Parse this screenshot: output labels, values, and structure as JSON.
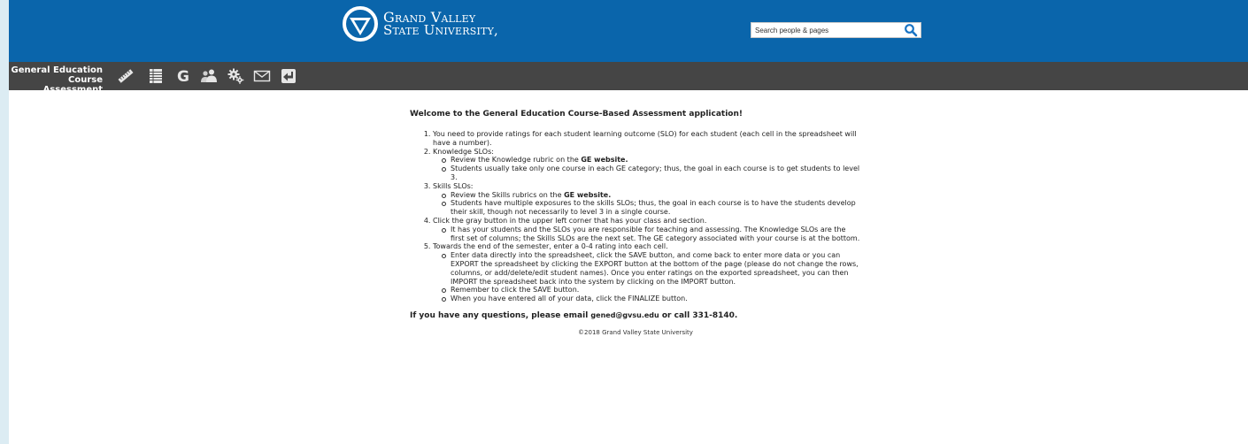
{
  "header": {
    "logo_line1": "Grand Valley",
    "logo_line2": "State University,",
    "search_placeholder": "Search people & pages"
  },
  "toolbar": {
    "title_line1": "General Education",
    "title_line2": "Course Assessment",
    "icons": [
      "ruler-icon",
      "spreadsheet-icon",
      "g-icon",
      "people-icon",
      "gears-icon",
      "mail-icon",
      "back-arrow-icon"
    ]
  },
  "main": {
    "heading": "Welcome to the General Education Course-Based Assessment application!",
    "item1": "You need to provide ratings for each student learning outcome (SLO) for each student (each cell in the spreadsheet will have a number).",
    "item2": "Knowledge SLOs:",
    "item2_sub1_pre": "Review the Knowledge rubric on the ",
    "item2_sub1_link": "GE website.",
    "item2_sub2": "Students usually take only one course in each GE category; thus, the goal in each course is to get students to level 3.",
    "item3": "Skills SLOs:",
    "item3_sub1_pre": "Review the Skills rubrics on the ",
    "item3_sub1_link": "GE website.",
    "item3_sub2": "Students have multiple exposures to the skills SLOs; thus, the goal in each course is to have the students develop their skill, though not necessarily to level 3 in a single course.",
    "item4": "Click the gray button in the upper left corner that has your class and section.",
    "item4_sub1": "It has your students and the SLOs you are responsible for teaching and assessing. The Knowledge SLOs are the first set of columns; the Skills SLOs are the next set. The GE category associated with your course is at the bottom.",
    "item5": "Towards the end of the semester, enter a 0-4 rating into each cell.",
    "item5_sub1": "Enter data directly into the spreadsheet, click the SAVE button, and come back to enter more data or you can EXPORT the spreadsheet by clicking the EXPORT button at the bottom of the page (please do not change the rows, columns, or add/delete/edit student names). Once you enter ratings on the exported spreadsheet, you can then IMPORT the spreadsheet back into the system by clicking on the IMPORT button.",
    "item5_sub2": "Remember to click the SAVE button.",
    "item5_sub3": "When you have entered all of your data, click the FINALIZE button.",
    "contact_pre": "If you have any questions, please email ",
    "contact_email": "gened@gvsu.edu",
    "contact_post": " or call 331-8140.",
    "copyright": "©2018 Grand Valley State University"
  },
  "colors": {
    "header_blue": "#0a65ab",
    "toolbar_gray": "#454545",
    "page_bg": "#dcecf3"
  }
}
